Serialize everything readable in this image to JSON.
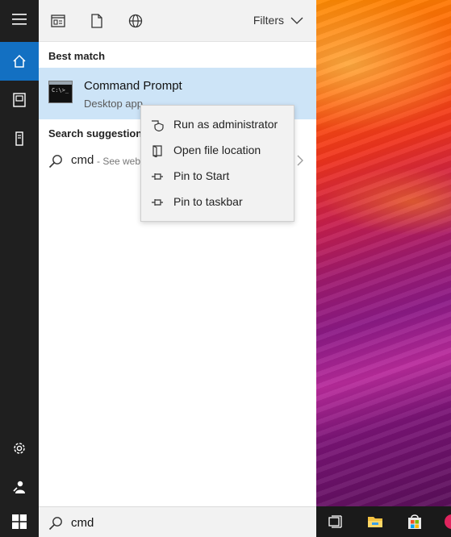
{
  "toolbar": {
    "filters_label": "Filters",
    "icons": [
      "apps-icon",
      "documents-icon",
      "web-icon"
    ]
  },
  "sidebar": {
    "items": [
      "home-icon",
      "documents-icon",
      "tower-icon",
      "settings-icon",
      "user-icon"
    ]
  },
  "best_match": {
    "heading": "Best match",
    "title": "Command Prompt",
    "subtitle": "Desktop app"
  },
  "suggestions": {
    "heading": "Search suggestions",
    "items": [
      {
        "main": "cmd",
        "sub": "- See web results"
      }
    ]
  },
  "context_menu": {
    "items": [
      {
        "label": "Run as administrator",
        "icon": "shield-icon"
      },
      {
        "label": "Open file location",
        "icon": "folder-icon"
      },
      {
        "label": "Pin to Start",
        "icon": "pin-icon"
      },
      {
        "label": "Pin to taskbar",
        "icon": "pin-icon"
      }
    ]
  },
  "search": {
    "value": "cmd"
  },
  "taskbar": {
    "icons": [
      "task-view-icon",
      "file-explorer-icon",
      "store-icon",
      "app-icon"
    ]
  },
  "colors": {
    "accent": "#1370c2",
    "selection": "#cde4f7",
    "rail": "#1f1f1f"
  }
}
